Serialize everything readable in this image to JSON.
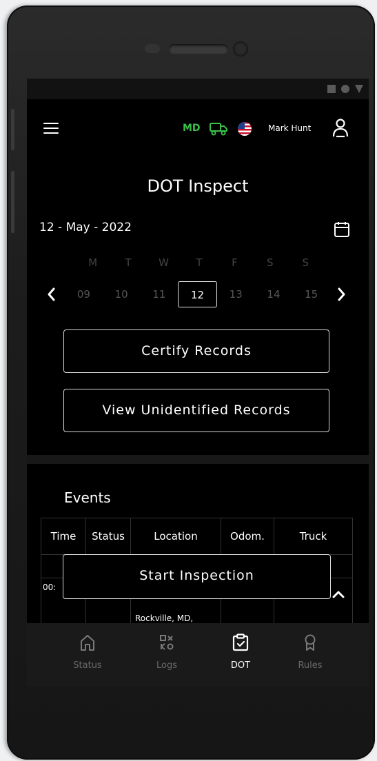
{
  "header": {
    "state": "MD",
    "driver_name": "Mark Hunt"
  },
  "page": {
    "title": "DOT Inspect",
    "date": "12 - May - 2022"
  },
  "week": {
    "days": [
      "M",
      "T",
      "W",
      "T",
      "F",
      "S",
      "S"
    ],
    "dates": [
      "09",
      "10",
      "11",
      "12",
      "13",
      "14",
      "15"
    ],
    "selected": "12"
  },
  "actions": {
    "certify": "Certify Records",
    "unidentified": "View Unidentified Records",
    "start_inspection": "Start Inspection"
  },
  "events": {
    "title": "Events",
    "columns": [
      "Time",
      "Status",
      "Location",
      "Odom.",
      "Truck"
    ],
    "rows": [
      {
        "time": "",
        "status": "",
        "location": "",
        "odom": "",
        "truck": ""
      },
      {
        "time": "00:",
        "status": "",
        "location": "Rockville, MD,",
        "odom": "",
        "truck": ""
      }
    ]
  },
  "nav": {
    "items": [
      {
        "label": "Status",
        "icon": "home-icon",
        "active": false
      },
      {
        "label": "Logs",
        "icon": "logs-icon",
        "active": false
      },
      {
        "label": "DOT",
        "icon": "clipboard-check-icon",
        "active": true
      },
      {
        "label": "Rules",
        "icon": "ribbon-icon",
        "active": false
      }
    ]
  },
  "colors": {
    "accent_green": "#3bbf4a",
    "background": "#000000",
    "nav_background": "#1a1a1a"
  }
}
